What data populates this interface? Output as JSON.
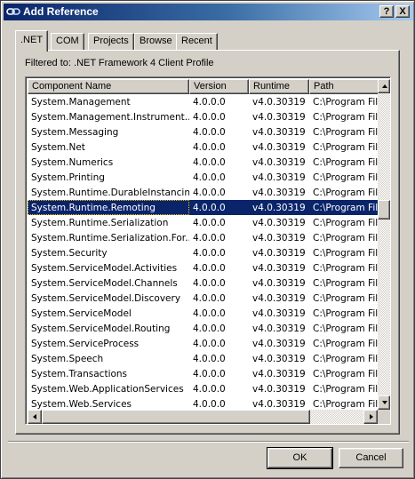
{
  "window": {
    "title": "Add Reference",
    "help_label": "?",
    "close_label": "X"
  },
  "tabs": [
    {
      "label": ".NET",
      "active": true
    },
    {
      "label": "COM",
      "active": false
    },
    {
      "label": "Projects",
      "active": false
    },
    {
      "label": "Browse",
      "active": false
    },
    {
      "label": "Recent",
      "active": false
    }
  ],
  "filter_text": "Filtered to: .NET Framework 4 Client Profile",
  "columns": [
    "Component Name",
    "Version",
    "Runtime",
    "Path"
  ],
  "rows": [
    [
      "System.Management",
      "4.0.0.0",
      "v4.0.30319",
      "C:\\Program Fil"
    ],
    [
      "System.Management.Instrument...",
      "4.0.0.0",
      "v4.0.30319",
      "C:\\Program Fil"
    ],
    [
      "System.Messaging",
      "4.0.0.0",
      "v4.0.30319",
      "C:\\Program Fil"
    ],
    [
      "System.Net",
      "4.0.0.0",
      "v4.0.30319",
      "C:\\Program Fil"
    ],
    [
      "System.Numerics",
      "4.0.0.0",
      "v4.0.30319",
      "C:\\Program Fil"
    ],
    [
      "System.Printing",
      "4.0.0.0",
      "v4.0.30319",
      "C:\\Program Fil"
    ],
    [
      "System.Runtime.DurableInstancing",
      "4.0.0.0",
      "v4.0.30319",
      "C:\\Program Fil"
    ],
    [
      "System.Runtime.Remoting",
      "4.0.0.0",
      "v4.0.30319",
      "C:\\Program Fil"
    ],
    [
      "System.Runtime.Serialization",
      "4.0.0.0",
      "v4.0.30319",
      "C:\\Program Fil"
    ],
    [
      "System.Runtime.Serialization.For...",
      "4.0.0.0",
      "v4.0.30319",
      "C:\\Program Fil"
    ],
    [
      "System.Security",
      "4.0.0.0",
      "v4.0.30319",
      "C:\\Program Fil"
    ],
    [
      "System.ServiceModel.Activities",
      "4.0.0.0",
      "v4.0.30319",
      "C:\\Program Fil"
    ],
    [
      "System.ServiceModel.Channels",
      "4.0.0.0",
      "v4.0.30319",
      "C:\\Program Fil"
    ],
    [
      "System.ServiceModel.Discovery",
      "4.0.0.0",
      "v4.0.30319",
      "C:\\Program Fil"
    ],
    [
      "System.ServiceModel",
      "4.0.0.0",
      "v4.0.30319",
      "C:\\Program Fil"
    ],
    [
      "System.ServiceModel.Routing",
      "4.0.0.0",
      "v4.0.30319",
      "C:\\Program Fil"
    ],
    [
      "System.ServiceProcess",
      "4.0.0.0",
      "v4.0.30319",
      "C:\\Program Fil"
    ],
    [
      "System.Speech",
      "4.0.0.0",
      "v4.0.30319",
      "C:\\Program Fil"
    ],
    [
      "System.Transactions",
      "4.0.0.0",
      "v4.0.30319",
      "C:\\Program Fil"
    ],
    [
      "System.Web.ApplicationServices",
      "4.0.0.0",
      "v4.0.30319",
      "C:\\Program Fil"
    ],
    [
      "System.Web.Services",
      "4.0.0.0",
      "v4.0.30319",
      "C:\\Program Fil"
    ]
  ],
  "selected_row": "System.Runtime.Remoting",
  "buttons": {
    "ok_label": "OK",
    "cancel_label": "Cancel"
  },
  "colors": {
    "selection": "#0a246a",
    "title_gradient_start": "#0a246a",
    "title_gradient_end": "#a6caf0",
    "face": "#d4d0c8"
  },
  "icons": {
    "title": "link-icon"
  }
}
